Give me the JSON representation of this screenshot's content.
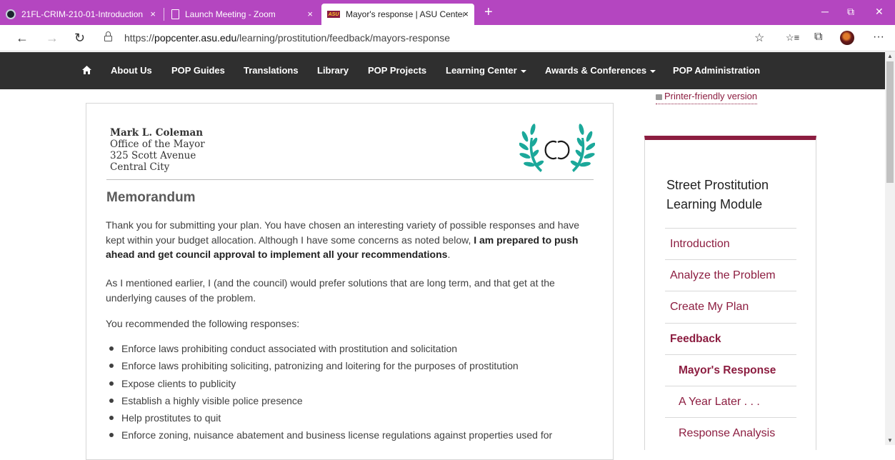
{
  "browser": {
    "tabs": [
      {
        "title": "21FL-CRIM-210-01-Introduction",
        "icon": "canvas-favicon-icon"
      },
      {
        "title": "Launch Meeting - Zoom",
        "icon": "page-icon"
      },
      {
        "title": "Mayor's response | ASU Center f",
        "icon": "asu-favicon-icon",
        "active": true
      }
    ],
    "favicon_asu_text": "ASU",
    "url_prefix": "https://",
    "url_host": "popcenter.asu.edu",
    "url_path": "/learning/prostitution/feedback/mayors-response",
    "tab_close": "×",
    "new_tab": "+",
    "window_controls": {
      "minimize": "─",
      "restore": "⧉",
      "close": "✕"
    },
    "nav": {
      "back": "←",
      "forward": "→",
      "refresh": "↻"
    },
    "toolbar": {
      "favorite": "☆",
      "favorites_list": "☆≡",
      "collections": "⧉",
      "more": "···"
    }
  },
  "site_nav": {
    "items": [
      "About Us",
      "POP Guides",
      "Translations",
      "Library",
      "POP Projects",
      "Learning Center",
      "Awards & Conferences",
      "POP Administration"
    ]
  },
  "memo": {
    "letterhead": {
      "name": "Mark L. Coleman",
      "line1": "Office of the Mayor",
      "line2": "325 Scott Avenue",
      "line3": "Central City"
    },
    "heading": "Memorandum",
    "p1_a": "Thank you for submitting your plan. You have chosen an interesting variety of possible responses and have kept within your budget allocation. Although I have some concerns as noted below, ",
    "p1_bold": "I am prepared to push ahead and get council approval to implement all your recommendations",
    "p1_end": ".",
    "p2": "As I mentioned earlier, I (and the council) would prefer solutions that are long term, and that get at the underlying causes of the problem.",
    "p3": "You recommended the following responses:",
    "responses": [
      "Enforce laws prohibiting conduct associated with prostitution and solicitation",
      "Enforce laws prohibiting soliciting, patronizing and loitering for the purposes of prostitution",
      "Expose clients to publicity",
      "Establish a highly visible police presence",
      "Help prostitutes to quit",
      "Enforce zoning, nuisance abatement and business license regulations against properties used for"
    ]
  },
  "sidebar": {
    "printer_link": "Printer-friendly version",
    "module_title": "Street Prostitution Learning Module",
    "items": [
      {
        "label": "Introduction"
      },
      {
        "label": "Analyze the Problem"
      },
      {
        "label": "Create My Plan"
      },
      {
        "label": "Feedback"
      },
      {
        "label": "Mayor's Response"
      },
      {
        "label": "A Year Later . . ."
      },
      {
        "label": "Response Analysis"
      }
    ]
  },
  "colors": {
    "tab_bar": "#b446c0",
    "site_nav": "#2f2f2f",
    "accent": "#8c1d40",
    "emblem": "#1ba89a"
  }
}
